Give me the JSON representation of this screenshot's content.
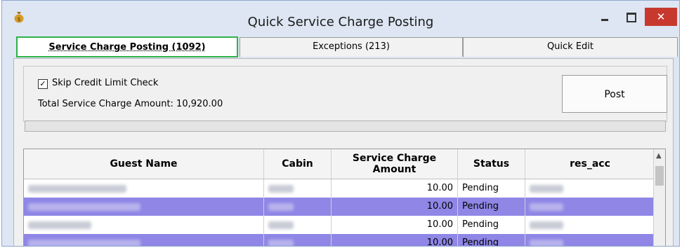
{
  "window": {
    "title": "Quick Service Charge Posting",
    "close_glyph": "✕"
  },
  "tabs": [
    {
      "label": "Service Charge Posting (1092)"
    },
    {
      "label": "Exceptions (213)"
    },
    {
      "label": "Quick Edit"
    }
  ],
  "options": {
    "skip_credit_label": "Skip Credit Limit Check",
    "skip_credit_checked": true,
    "total_label": "Total Service Charge Amount: 10,920.00"
  },
  "post_button": {
    "label": "Post"
  },
  "grid": {
    "columns": [
      "Guest Name",
      "Cabin",
      "Service Charge Amount",
      "Status",
      "res_acc"
    ],
    "rows": [
      {
        "amount": "10.00",
        "status": "Pending",
        "selected": false
      },
      {
        "amount": "10.00",
        "status": "Pending",
        "selected": true
      },
      {
        "amount": "10.00",
        "status": "Pending",
        "selected": false
      },
      {
        "amount": "10.00",
        "status": "Pending",
        "selected": true
      }
    ]
  },
  "colors": {
    "selection": "#8f86e6",
    "tab_highlight": "#2fb24a",
    "close": "#c7392f"
  }
}
